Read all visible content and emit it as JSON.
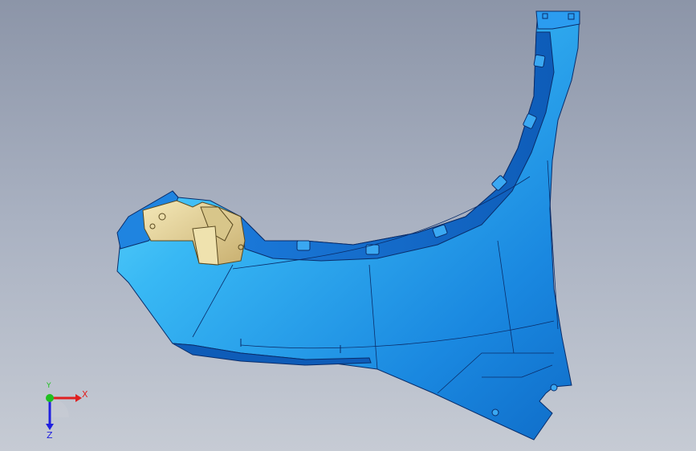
{
  "viewport": {
    "background_top": "#8c95a8",
    "background_bottom": "#c6cbd4"
  },
  "model": {
    "part_color": "#1e8fe8",
    "part_highlight": "#5ad8ff",
    "edge_color": "#0a2d6a",
    "bracket_color": "#e8d9a0",
    "bracket_shadow": "#b8a468"
  },
  "triad": {
    "x_label": "X",
    "y_label": "Y",
    "z_label": "Z",
    "x_color": "#e02020",
    "y_color": "#20c020",
    "z_color": "#2020e0"
  }
}
